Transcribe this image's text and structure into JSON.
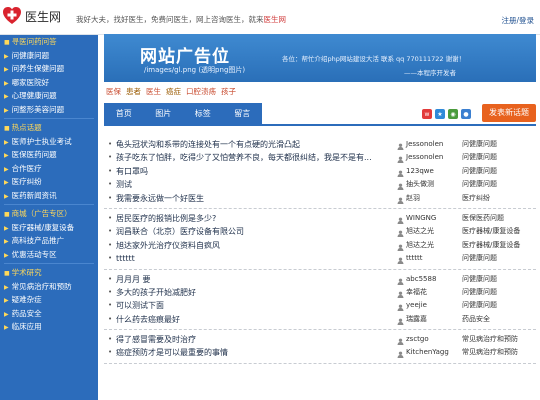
{
  "header": {
    "site_name": "医生网",
    "slogan_prefix": "我好大夫，找好医生，免费问医生，网上咨询医生，就来",
    "slogan_highlight": "医生网",
    "auth_label": "注册/登录"
  },
  "sidebar": {
    "groups": [
      {
        "title": "寻医问药问答",
        "items": [
          "问健康问题",
          "问养生保健问题",
          "哪家医院好",
          "心理健康问题",
          "问整形美容问题"
        ]
      },
      {
        "title": "热点话题",
        "items": [
          "医师护士执业考试",
          "医保医药问题",
          "合作医疗",
          "医疗纠纷",
          "医药新闻资讯"
        ]
      },
      {
        "title": "商城（广告专区）",
        "items": [
          "医疗器械/康复设备",
          "高科技产品推广",
          "优惠活动专区"
        ]
      },
      {
        "title": "学术研究",
        "items": [
          "常见病治疗和预防",
          "疑难杂症",
          "药品安全",
          "临床应用"
        ]
      }
    ]
  },
  "banner": {
    "title": "网站广告位",
    "path": "/images/gl.png  (透明png图片)",
    "contact": "各位：帮忙介绍php网站建设大活  联系 qq  770111722 谢谢！",
    "note": "——本程序开发者"
  },
  "tags": [
    "医保",
    "患者",
    "医生",
    "癌症",
    "口腔溃疡",
    "孩子"
  ],
  "nav": {
    "tabs": [
      "首页",
      "图片",
      "标签",
      "留言"
    ],
    "new_topic_label": "发表新话题"
  },
  "topics": [
    [
      {
        "title": "龟头冠状沟和系带的连接处有一个有点硬的光滑凸起",
        "user": "Jessonolen",
        "category": "问健康问题"
      },
      {
        "title": "孩子吃东了怕胖，吃得少了又怕营养不良，每天都很纠结，我是不是有...",
        "user": "Jessonolen",
        "category": "问健康问题"
      },
      {
        "title": "有口罩吗",
        "user": "123qwe",
        "category": "问健康问题"
      },
      {
        "title": "测试",
        "user": "抽头做测",
        "category": "问健康问题"
      },
      {
        "title": "我需要永远做一个好医生",
        "user": "赵羽",
        "category": "医疗纠纷"
      }
    ],
    [
      {
        "title": "居民医疗的报销比例是多少?",
        "user": "WINGNG",
        "category": "医保医药问题"
      },
      {
        "title": "润昌联合（北京）医疗设备有限公司",
        "user": "旭达之光",
        "category": "医疗器械/康复设备"
      },
      {
        "title": "旭达家外光治疗仪资料自疯风",
        "user": "旭达之光",
        "category": "医疗器械/康复设备"
      },
      {
        "title": "tttttt",
        "user": "tttttt",
        "category": "问健康问题"
      }
    ],
    [
      {
        "title": "月月月 要",
        "user": "abc5588",
        "category": "问健康问题"
      },
      {
        "title": "多大的孩子开始减肥好",
        "user": "幸福花",
        "category": "问健康问题"
      },
      {
        "title": "可以测试下面",
        "user": "yeejie",
        "category": "问健康问题"
      },
      {
        "title": "什么药去癌痕最好",
        "user": "瑞露嘉",
        "category": "药品安全"
      }
    ],
    [
      {
        "title": "得了感冒需要及时治疗",
        "user": "zsctgo",
        "category": "常见病治疗和预防"
      },
      {
        "title": "癌症预防才是可以最重要的事情",
        "user": "KitchenYagg",
        "category": "常见病治疗和预防"
      }
    ]
  ],
  "colors": {
    "sidebar_bg": "#2c6cbb",
    "accent_yellow": "#ffd95a",
    "new_topic_orange": "#e8621e"
  }
}
